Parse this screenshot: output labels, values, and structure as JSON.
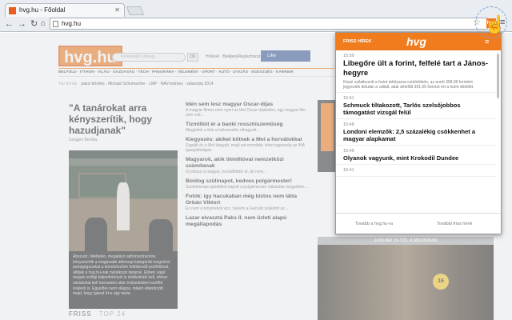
{
  "browser": {
    "tab_title": "hvg.hu - Főoldal",
    "url": "hvg.hu",
    "extension_badge": "hvg"
  },
  "site": {
    "logo": "hvg.hu",
    "search_placeholder": "Keresendő szöveg...",
    "search_ok": "OK",
    "header_links": "Hírlevél · Belépés/Regisztráció",
    "facebook_like": "Like",
    "facebook_count": "77k",
    "nav": "BELFÖLD · ITTHON · VILÁG · GAZDASÁG · TECH · PANORÁMA · VÉLEMÉNY · SPORT · AUTÓ · UTAZÁS · EGÉSZSÉG · KARRIER",
    "sub_label": "Top témák",
    "sub_items": "paksi bővítés · Michael Schumacher · LMP · NAV-botrány · választás 2014",
    "main_headline": "\"A tanárokat arra kényszerítik, hogy hazudjanak\"",
    "main_author": "Szegjen Boróka",
    "photo_caption": "Abszurd, hiteltelen, megalázó adminisztrációra kényszerítik a magasabb átlémegi kategóriát megcélzó pedagógusokat a követelezően feltöltendő portfólióval, állítják a hvg.hu-nak nyilatkozó tanárok. Ebben saját maguk erdőgi teljesítményét is értékelniük kell, ehhez vázlatokat kell bemutatni akár évtizedekkel ezelőtti óráikról is. Egyelőre nem világos, mikért ellenőrzött majd, hogy igazat írt-e egy tanár.",
    "friss": "FRISS",
    "top24": "TOP 24",
    "articles": [
      {
        "title": "Idén sem lesz magyar Oscar-díjas",
        "desc": "A magyar filmes nem nyert az idei Oscar-díjátadón, egy magyar film sem volt..."
      },
      {
        "title": "Tízmilliót ér a banki rosszhiszeműség",
        "desc": "Megjelent a fotó a hétszerelés elhagyott..."
      },
      {
        "title": "Kiegyezés: akiket kötnek a Mol a horvátokkal",
        "desc": "Zagráb és a Mol tárgyalt, majd azt mondták: lehet egyezség az INA igazgatóságán"
      },
      {
        "title": "Magyarok, akik ötmillióval nemzetközi számítanak",
        "desc": "Új stílusú a magyar, ha külföldön él, de nem..."
      },
      {
        "title": "Boldog szülinapot, kedves polgármester!",
        "desc": "Születésnapi ajándékot kapott a polgármester választás megyében..."
      },
      {
        "title": "Fotók: így hacukaban még biztos nem látta Orbán Viktort",
        "desc": "Ez nem a ténymelyik vicc, hanem a Felcsúti szakértő ez..."
      },
      {
        "title": "Lazar elvasztá Paks II. nem üzleti alapú megállapodás",
        "desc": ""
      }
    ],
    "moziban": "JANUÁR 15-TŐL A MOZIKBAN",
    "movie_badge": "16"
  },
  "popup": {
    "header_label": "FRISS HÍREK",
    "logo": "hvg",
    "items": [
      {
        "time": "15:50",
        "title": "Libegőre ült a forint, felfelé tart a János-hegyre",
        "desc": "Kissé nyilatkozott a forint árfolyama csütörtökön, az eurót 308,99 forintért jegyezték délután a vállalt, akár délelőtt 301,05 forintot ért a forint délelőtt."
      },
      {
        "time": "15:51",
        "title": "Schmuck tiltakozott, Tarlós szelsőjobbos támogatást vizsgál felül",
        "desc": ""
      },
      {
        "time": "15:46",
        "title": "Londoni elemzők: 2,5 százalékig csökkenhet a magyar alapkamat",
        "desc": ""
      },
      {
        "time": "15:45",
        "title": "Olyanok vagyunk, mint Krokodil Dundee",
        "desc": ""
      },
      {
        "time": "15:41",
        "title": "",
        "desc": ""
      }
    ],
    "footer_left": "Tovább a hvg.hu-ra",
    "footer_right": "További friss hírek"
  },
  "colors": {
    "brand": "#f07c1e",
    "facebook": "#3b5998"
  }
}
